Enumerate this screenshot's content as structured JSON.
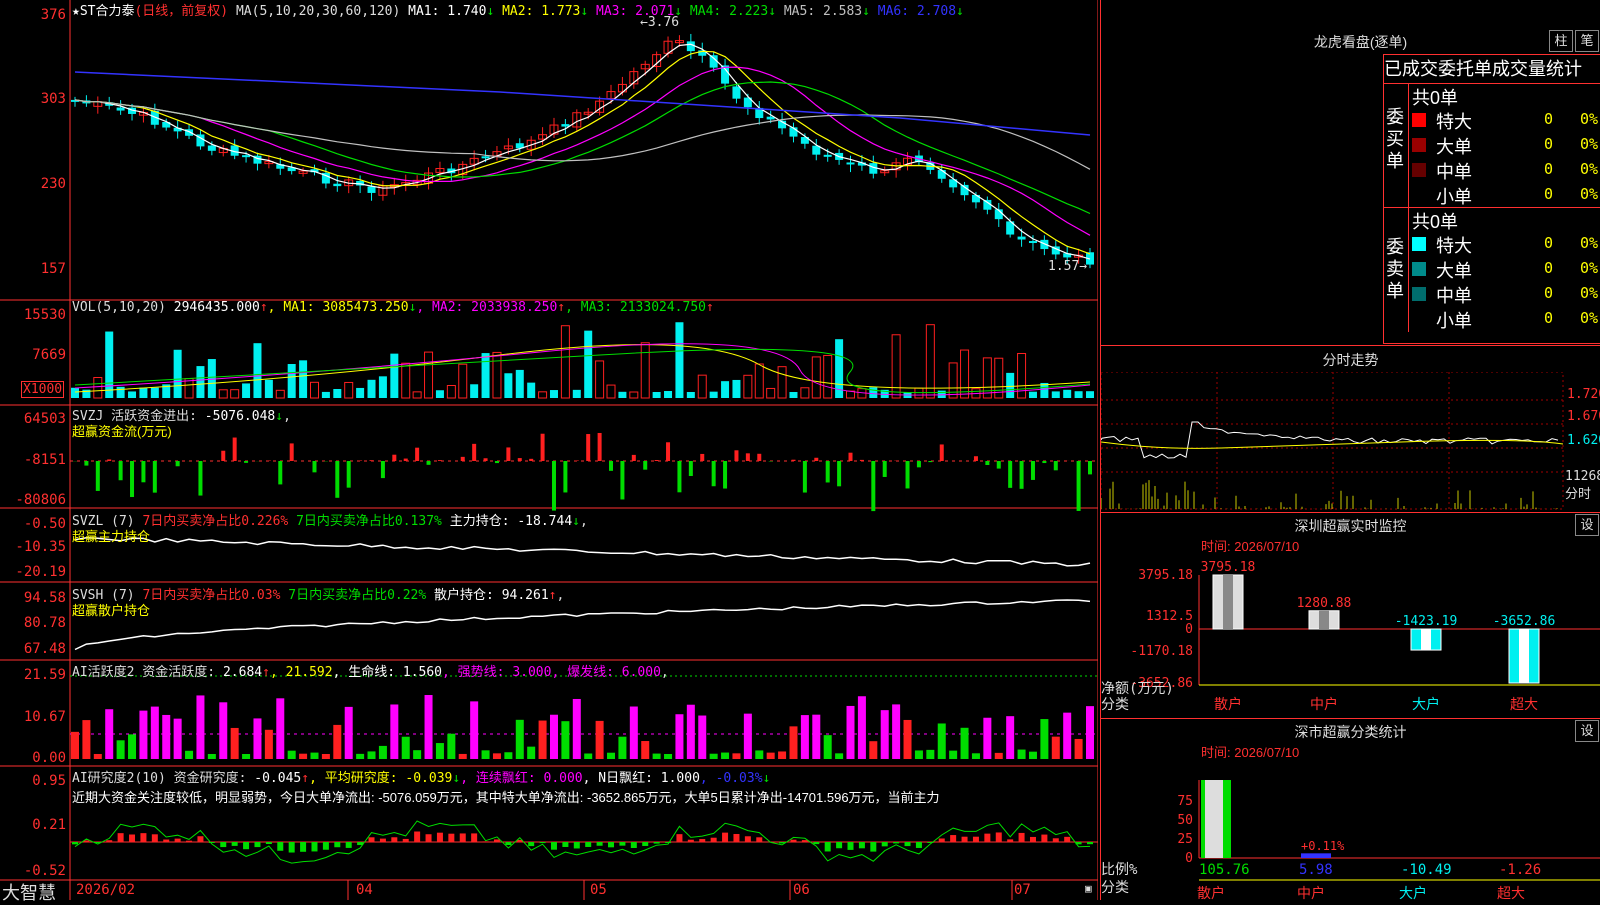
{
  "app": {
    "logo": "大智慧"
  },
  "colors": {
    "up": "#ff2020",
    "down": "#00f0f0",
    "grid": "#a00000",
    "axis": "#ff3030",
    "ma1": "#ffffff",
    "ma2": "#ffff00",
    "ma3": "#ff00ff",
    "ma4": "#00dd00",
    "ma5": "#c0c0c0",
    "ma6": "#3333ff",
    "green": "#00dd00"
  },
  "main": {
    "legend": [
      {
        "text": "★ST合力泰",
        "color": "#ffffff"
      },
      {
        "text": "(日线，前复权)",
        "color": "#ff3030"
      },
      {
        "text": " MA(5,10,20,30,60,120) ",
        "color": "#dddddd"
      },
      {
        "text": "MA1: 1.740",
        "color": "#ffffff"
      },
      {
        "text": "↓",
        "color": "#00dd00"
      },
      {
        "text": " MA2: 1.773",
        "color": "#ffff00"
      },
      {
        "text": "↓",
        "color": "#00dd00"
      },
      {
        "text": " MA3: 2.071",
        "color": "#ff00ff"
      },
      {
        "text": "↓",
        "color": "#00dd00"
      },
      {
        "text": " MA4: 2.223",
        "color": "#00dd00"
      },
      {
        "text": "↓",
        "color": "#00dd00"
      },
      {
        "text": " MA5: 2.583",
        "color": "#c0c0c0"
      },
      {
        "text": "↓",
        "color": "#00dd00"
      },
      {
        "text": " MA6: 2.708",
        "color": "#3333ff"
      },
      {
        "text": "↓",
        "color": "#00dd00"
      }
    ],
    "yticks": [
      "376",
      "303",
      "230",
      "157"
    ],
    "high_label": "3.76",
    "low_label": "1.57"
  },
  "vol": {
    "legend": [
      {
        "text": "VOL(5,10,20) ",
        "color": "#dddddd"
      },
      {
        "text": "2946435.000",
        "color": "#ffffff"
      },
      {
        "text": "↑",
        "color": "#ff3030"
      },
      {
        "text": ", MA1: 3085473.250",
        "color": "#ffff00"
      },
      {
        "text": "↓",
        "color": "#00dd00"
      },
      {
        "text": ", MA2: 2033938.250",
        "color": "#ff00ff"
      },
      {
        "text": "↑",
        "color": "#ff3030"
      },
      {
        "text": ", MA3: 2133024.750",
        "color": "#00dd00"
      },
      {
        "text": "↑",
        "color": "#ff3030"
      }
    ],
    "yticks": [
      "15530",
      "7669"
    ],
    "unit": "X1000"
  },
  "svzj": {
    "legend": [
      {
        "text": "SVZJ  活跃资金进出: ",
        "color": "#dddddd"
      },
      {
        "text": "-5076.048",
        "color": "#ffffff"
      },
      {
        "text": "↓",
        "color": "#00dd00"
      },
      {
        "text": ",",
        "color": "#dddddd"
      }
    ],
    "sub": "超赢资金流(万元)",
    "yticks": [
      "64503",
      "-8151",
      "-80806"
    ]
  },
  "svzl": {
    "legend": [
      {
        "text": "SVZL (7) ",
        "color": "#dddddd"
      },
      {
        "text": "7日内买卖净占比0.226%",
        "color": "#ff3030"
      },
      {
        "text": " 7日内买卖净占比0.137%",
        "color": "#00dd00"
      },
      {
        "text": " 主力持仓: -18.744",
        "color": "#ffffff"
      },
      {
        "text": "↓",
        "color": "#00dd00"
      },
      {
        "text": ",",
        "color": "#dddddd"
      }
    ],
    "sub": "超赢主力持仓",
    "yticks": [
      "-0.50",
      "-10.35",
      "-20.19"
    ]
  },
  "svsh": {
    "legend": [
      {
        "text": "SVSH (7) ",
        "color": "#dddddd"
      },
      {
        "text": "7日内买卖净占比0.03%",
        "color": "#ff3030"
      },
      {
        "text": " 7日内买卖净占比0.22%",
        "color": "#00dd00"
      },
      {
        "text": " 散户持仓: 94.261",
        "color": "#ffffff"
      },
      {
        "text": "↑",
        "color": "#ff3030"
      },
      {
        "text": ",",
        "color": "#dddddd"
      }
    ],
    "sub": "超赢散户持仓",
    "yticks": [
      "94.58",
      "80.78",
      "67.48"
    ]
  },
  "ai1": {
    "legend": [
      {
        "text": "AI活跃度2 资金活跃度: ",
        "color": "#dddddd"
      },
      {
        "text": "2.684",
        "color": "#ffffff"
      },
      {
        "text": "↑",
        "color": "#ff3030"
      },
      {
        "text": ", 21.592",
        "color": "#ffff00"
      },
      {
        "text": ", 生命线: 1.560",
        "color": "#ffffff"
      },
      {
        "text": ", 强势线: 3.000",
        "color": "#ff00ff"
      },
      {
        "text": ", 爆发线: 6.000",
        "color": "#ff00ff"
      },
      {
        "text": ",",
        "color": "#dddddd"
      }
    ],
    "yticks": [
      "21.59",
      "10.67",
      "0.00"
    ]
  },
  "ai2": {
    "legend": [
      {
        "text": "AI研究度2(10) 资金研究度: ",
        "color": "#dddddd"
      },
      {
        "text": "-0.045",
        "color": "#ffffff"
      },
      {
        "text": "↑",
        "color": "#ff3030"
      },
      {
        "text": ", 平均研究度: -0.039",
        "color": "#ffff00"
      },
      {
        "text": "↓",
        "color": "#00dd00"
      },
      {
        "text": ", 连续飘红: 0.000",
        "color": "#ff00ff"
      },
      {
        "text": ", N日飘红: 1.000",
        "color": "#ffffff"
      },
      {
        "text": ", -0.03%",
        "color": "#3333ff"
      },
      {
        "text": "↓",
        "color": "#00dd00"
      }
    ],
    "commentary": "近期大资金关注度较低，明显弱势，今日大单净流出: -5076.059万元，其中特大单净流出: -3652.865万元，大单5日累计净出-14701.596万元，当前主力",
    "yticks": [
      "0.95",
      "0.21",
      "-0.52"
    ]
  },
  "xaxis": {
    "labels": [
      "2026/02",
      "04",
      "05",
      "06",
      "07"
    ]
  },
  "longhu": {
    "title": "龙虎看盘(逐单)",
    "btn1": "柱",
    "btn2": "笔",
    "header": "已成交委托单成交量统计",
    "buy_side": "委买单",
    "sell_side": "委卖单",
    "buy_total": "共0单",
    "sell_total": "共0单",
    "buy_rows": [
      {
        "name": "特大",
        "count": "0",
        "pct": "0%",
        "color": "#ff0000"
      },
      {
        "name": "大单",
        "count": "0",
        "pct": "0%",
        "color": "#990000"
      },
      {
        "name": "中单",
        "count": "0",
        "pct": "0%",
        "color": "#660000"
      },
      {
        "name": "小单",
        "count": "0",
        "pct": "0%",
        "color": "#000000"
      }
    ],
    "sell_rows": [
      {
        "name": "特大",
        "count": "0",
        "pct": "0%",
        "color": "#00ffff"
      },
      {
        "name": "大单",
        "count": "0",
        "pct": "0%",
        "color": "#008b8b"
      },
      {
        "name": "中单",
        "count": "0",
        "pct": "0%",
        "color": "#006d6d"
      },
      {
        "name": "小单",
        "count": "0",
        "pct": "0%",
        "color": "#000000"
      }
    ]
  },
  "fenshi": {
    "title": "分时走势",
    "prices": [
      "1.720",
      "1.670",
      "1.620"
    ],
    "vol_label": "11268",
    "unit_label": "分时"
  },
  "shenzhen_monitor": {
    "title": "深圳超赢实时监控",
    "settings": "设",
    "time": "时间: 2026/07/10",
    "yticks": [
      "3795.18",
      "1312.5",
      "0",
      "-1170.18",
      "-3652.86"
    ],
    "ylabel": "净额(万元)",
    "xlabel": "分类",
    "categories": [
      "散户",
      "中户",
      "大户",
      "超大"
    ],
    "values": [
      3795.18,
      1280.88,
      -1423.19,
      -3652.86
    ],
    "value_labels": [
      "3795.18",
      "1280.88",
      "-1423.19",
      "-3652.86"
    ]
  },
  "shenzhen_class": {
    "title": "深市超赢分类统计",
    "settings": "设",
    "time": "时间: 2026/07/10",
    "yticks": [
      "75",
      "50",
      "25",
      "0"
    ],
    "ylabel": "比例%",
    "xlabel": "分类",
    "categories": [
      "散户",
      "中户",
      "大户",
      "超大"
    ],
    "values": [
      105.76,
      5.98,
      -10.49,
      -1.26
    ],
    "value_labels": [
      "105.76",
      "5.98",
      "-10.49",
      "-1.26"
    ],
    "extra_label": "+0.11%"
  },
  "chart_data": {
    "type": "bar",
    "title": "深圳超赢实时监控",
    "categories": [
      "散户",
      "中户",
      "大户",
      "超大"
    ],
    "values": [
      3795.18,
      1280.88,
      -1423.19,
      -3652.86
    ],
    "xlabel": "分类",
    "ylabel": "净额(万元)",
    "ylim": [
      -3652.86,
      3795.18
    ]
  }
}
